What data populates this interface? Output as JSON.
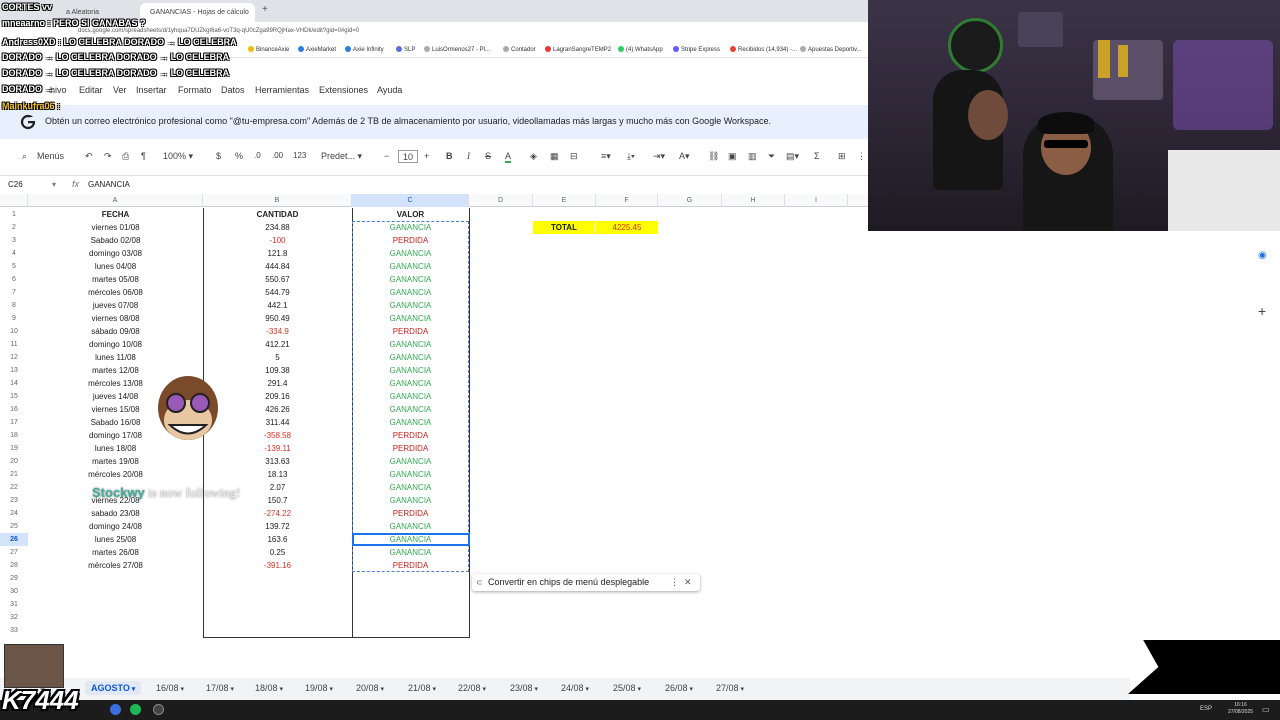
{
  "browser": {
    "tabs": [
      {
        "label": "a Aleatoria",
        "active": false
      },
      {
        "label": "GANANCIAS - Hojas de cálculo",
        "active": true
      }
    ],
    "url": "docs.google.com/spreadsheets/d/1yhqua7DUZkgI6a6-voT3q-qU0cZga99RQjHax-VHDk/edit?gid=0#gid=0",
    "bookmarks": [
      "BinanceAxie",
      "AxieMarket",
      "Axie Infinity",
      "SLP",
      "LuisOrmenos27 - Pl...",
      "Contador",
      "LagranSangreTEMP2",
      "(4) WhatsApp",
      "Stripe Express",
      "Recibidos (14,934) -...",
      "Apuestas Deportiv..."
    ]
  },
  "menu": {
    "items": [
      "Editar",
      "Ver",
      "Insertar",
      "Formato",
      "Datos",
      "Herramientas",
      "Extensiones",
      "Ayuda"
    ],
    "partial_first": "hivo"
  },
  "banner": {
    "text": "Obtén un correo electrónico profesional como \"@tu-empresa.com\"  Además de 2 TB de almacenamiento por usuario, videollamadas más largas y mucho más con Google Workspace."
  },
  "toolbar": {
    "menus_label": "Menús",
    "zoom": "100%",
    "currency": "$",
    "percent": "%",
    "dec_less": ".0",
    "dec_more": ".00",
    "number_format": "123",
    "font": "Predet...",
    "font_size": "10"
  },
  "formula_bar": {
    "cell_ref": "C26",
    "content": "GANANCIA"
  },
  "columns": [
    "A",
    "B",
    "C",
    "D",
    "E",
    "F",
    "G",
    "H",
    "I"
  ],
  "headers": {
    "fecha": "FECHA",
    "cantidad": "CANTIDAD",
    "valor": "VALOR"
  },
  "rows": [
    {
      "fecha": "viernes 01/08",
      "cantidad": "234.88",
      "valor": "GANANCIA"
    },
    {
      "fecha": "Sabado 02/08",
      "cantidad": "-100",
      "valor": "PERDIDA"
    },
    {
      "fecha": "domingo 03/08",
      "cantidad": "121.8",
      "valor": "GANANCIA"
    },
    {
      "fecha": "lunes 04/08",
      "cantidad": "444.84",
      "valor": "GANANCIA"
    },
    {
      "fecha": "martes 05/08",
      "cantidad": "550.67",
      "valor": "GANANCIA"
    },
    {
      "fecha": "mércoles 06/08",
      "cantidad": "544.79",
      "valor": "GANANCIA"
    },
    {
      "fecha": "jueves 07/08",
      "cantidad": "442.1",
      "valor": "GANANCIA"
    },
    {
      "fecha": "viernes 08/08",
      "cantidad": "950.49",
      "valor": "GANANCIA"
    },
    {
      "fecha": "sábado 09/08",
      "cantidad": "-334.9",
      "valor": "PERDIDA"
    },
    {
      "fecha": "domingo 10/08",
      "cantidad": "412.21",
      "valor": "GANANCIA"
    },
    {
      "fecha": "lunes 11/08",
      "cantidad": "5",
      "valor": "GANANCIA"
    },
    {
      "fecha": "martes 12/08",
      "cantidad": "109.38",
      "valor": "GANANCIA"
    },
    {
      "fecha": "mércoles 13/08",
      "cantidad": "291.4",
      "valor": "GANANCIA"
    },
    {
      "fecha": "jueves 14/08",
      "cantidad": "209.16",
      "valor": "GANANCIA"
    },
    {
      "fecha": "viernes 15/08",
      "cantidad": "426.26",
      "valor": "GANANCIA"
    },
    {
      "fecha": "Sabado 16/08",
      "cantidad": "311.44",
      "valor": "GANANCIA"
    },
    {
      "fecha": "domingo 17/08",
      "cantidad": "-358.58",
      "valor": "PERDIDA"
    },
    {
      "fecha": "lunes 18/08",
      "cantidad": "-139.11",
      "valor": "PERDIDA"
    },
    {
      "fecha": "martes 19/08",
      "cantidad": "313.63",
      "valor": "GANANCIA"
    },
    {
      "fecha": "mércoles 20/08",
      "cantidad": "18.13",
      "valor": "GANANCIA"
    },
    {
      "fecha": "",
      "cantidad": "2.07",
      "valor": "GANANCIA"
    },
    {
      "fecha": "viernes 22/08",
      "cantidad": "150.7",
      "valor": "GANANCIA"
    },
    {
      "fecha": "sabado 23/08",
      "cantidad": "-274.22",
      "valor": "PERDIDA"
    },
    {
      "fecha": "domingo 24/08",
      "cantidad": "139.72",
      "valor": "GANANCIA"
    },
    {
      "fecha": "lunes 25/08",
      "cantidad": "163.6",
      "valor": "GANANCIA"
    },
    {
      "fecha": "martes 26/08",
      "cantidad": "0.25",
      "valor": "GANANCIA"
    },
    {
      "fecha": "mércoles 27/08",
      "cantidad": "-391.16",
      "valor": "PERDIDA"
    }
  ],
  "total": {
    "label": "TOTAL",
    "value": "4225.45"
  },
  "chips_popup": {
    "text": "Convertir en chips de menú desplegable"
  },
  "sheet_tabs": [
    "AGOSTO",
    "16/08",
    "17/08",
    "18/08",
    "19/08",
    "20/08",
    "21/08",
    "22/08",
    "23/08",
    "24/08",
    "25/08",
    "26/08",
    "27/08"
  ],
  "active_sheet": "AGOSTO",
  "overlays": {
    "chat_lines": [
      "CORTES vv",
      "mneaarno : PERO SI GANABAS ?",
      "Andress0XD : LO CELEBRA DORADO → LO CELEBRA",
      "DORADO → LO CELEBRA DORADO → LO CELEBRA",
      "DORADO → LO CELEBRA DORADO → LO CELEBRA",
      "DORADO → ",
      "Mainkufra06 :"
    ],
    "follow_user": "Stockwy",
    "follow_text": " is now following!",
    "corner_text": "K7444"
  },
  "taskbar": {
    "time": "16:16",
    "date": "27/08/2025",
    "lang": "ESP"
  },
  "colors": {
    "ganancia": "#34a853",
    "perdida": "#c5221f",
    "total_bg": "#ffff00",
    "selection": "#1a73e8"
  }
}
